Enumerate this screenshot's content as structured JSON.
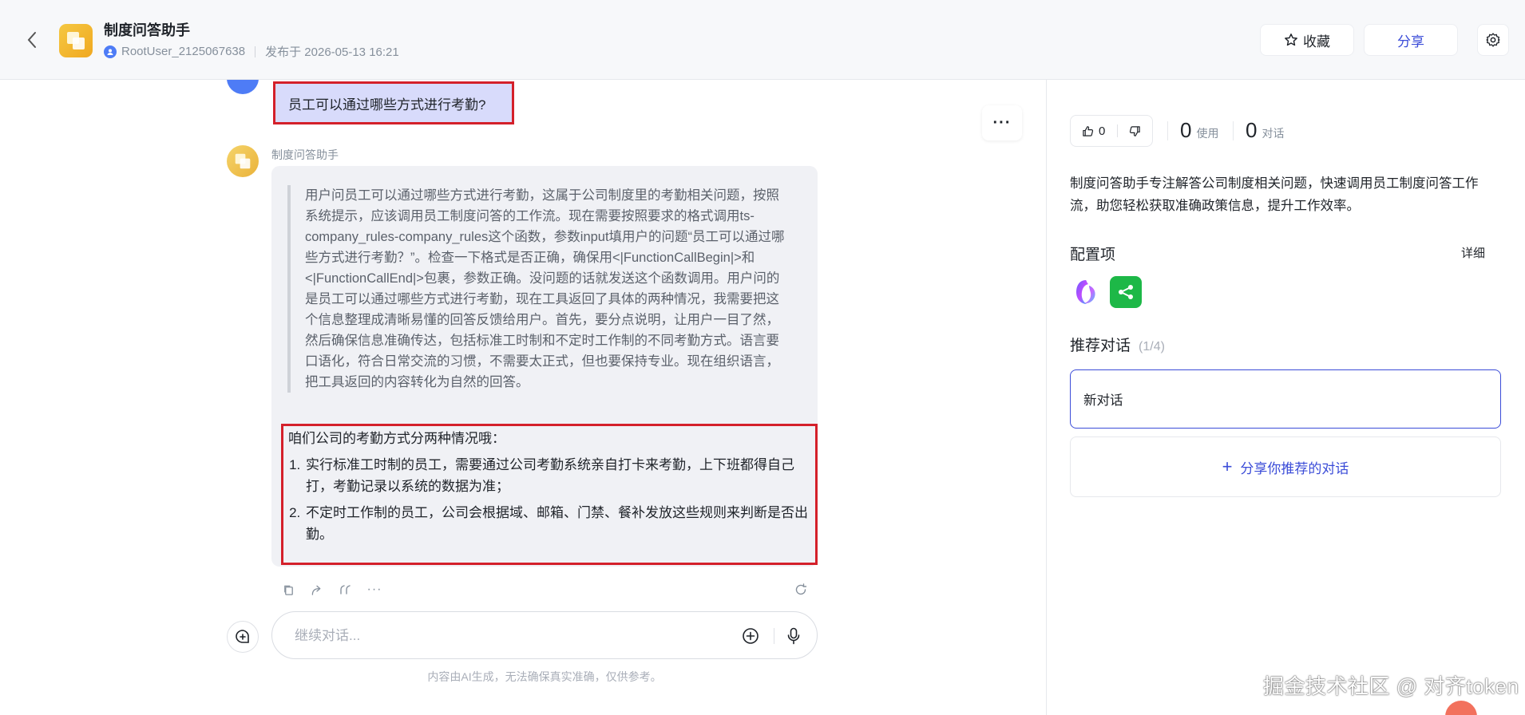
{
  "header": {
    "app_title": "制度问答助手",
    "user_name": "RootUser_2125067638",
    "publish_time": "发布于 2026-05-13 16:21",
    "favorite_label": "收藏",
    "share_label": "分享"
  },
  "chat": {
    "user_message": "员工可以通过哪些方式进行考勤?",
    "bot_name": "制度问答助手",
    "thinking": "用户问员工可以通过哪些方式进行考勤，这属于公司制度里的考勤相关问题，按照系统提示，应该调用员工制度问答的工作流。现在需要按照要求的格式调用ts-company_rules-company_rules这个函数，参数input填用户的问题“员工可以通过哪些方式进行考勤？”。检查一下格式是否正确，确保用<|FunctionCallBegin|>和<|FunctionCallEnd|>包裹，参数正确。没问题的话就发送这个函数调用。用户问的是员工可以通过哪些方式进行考勤，现在工具返回了具体的两种情况，我需要把这个信息整理成清晰易懂的回答反馈给用户。首先，要分点说明，让用户一目了然，然后确保信息准确传达，包括标准工时制和不定时工作制的不同考勤方式。语言要口语化，符合日常交流的习惯，不需要太正式，但也要保持专业。现在组织语言，把工具返回的内容转化为自然的回答。",
    "answer_intro": "咱们公司的考勤方式分两种情况哦：",
    "answer_items": [
      "实行标准工时制的员工，需要通过公司考勤系统亲自打卡来考勤，上下班都得自己打，考勤记录以系统的数据为准；",
      "不定时工作制的员工，公司会根据域、邮箱、门禁、餐补发放这些规则来判断是否出勤。"
    ],
    "input_placeholder": "继续对话...",
    "disclaimer": "内容由AI生成，无法确保真实准确，仅供参考。"
  },
  "sidebar": {
    "like_count": "0",
    "usage_count": "0",
    "usage_label": "使用",
    "conversation_count": "0",
    "conversation_label": "对话",
    "description": "制度问答助手专注解答公司制度相关问题，快速调用员工制度问答工作流，助您轻松获取准确政策信息，提升工作效率。",
    "config_title": "配置项",
    "detail_label": "详细",
    "recommend_title": "推荐对话",
    "recommend_count": "(1/4)",
    "recommend_items": [
      "新对话"
    ],
    "share_recommend_label": "分享你推荐的对话"
  },
  "watermark": "掘金技术社区 @ 对齐token",
  "colors": {
    "accent": "#3b4cd8",
    "highlight_border": "#d4202a",
    "user_bubble": "#d8dbfb",
    "bot_bubble": "#f0f1f5",
    "plugin_green": "#1db847"
  },
  "icons": [
    "back-icon",
    "app-logo-icon",
    "user-icon",
    "star-icon",
    "gear-icon",
    "more-icon",
    "copy-icon",
    "forward-icon",
    "quote-icon",
    "ellipsis-icon",
    "refresh-icon",
    "new-chat-icon",
    "add-icon",
    "mic-icon",
    "thumbs-up-icon",
    "thumbs-down-icon",
    "plugin-icon",
    "workflow-icon"
  ]
}
